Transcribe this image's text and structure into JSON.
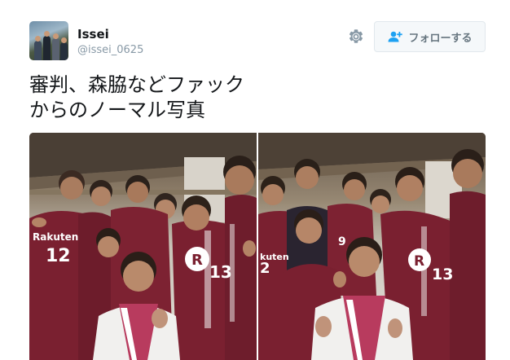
{
  "user": {
    "name": "Issei",
    "handle": "@issei_0625"
  },
  "actions": {
    "follow_label": "フォローする",
    "settings_icon": "gear-icon",
    "follow_icon": "add-user-icon"
  },
  "tweet": {
    "lines": [
      "審判、森脇などファック",
      "からのノーマル写真"
    ]
  },
  "media": {
    "photos": [
      {
        "jersey_text": [
          "Rakuten",
          "12",
          "R",
          "13"
        ]
      },
      {
        "jersey_text": [
          "kuten",
          "2",
          "9",
          "R",
          "13"
        ]
      }
    ]
  },
  "colors": {
    "accent": "#1da1f2",
    "muted": "#8899a6",
    "jersey": "#7a2030",
    "button_bg": "#f5f8fa"
  }
}
